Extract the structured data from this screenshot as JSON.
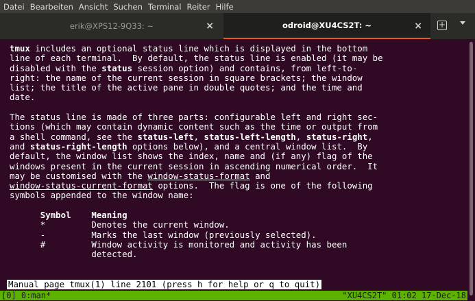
{
  "menu": [
    "Datei",
    "Bearbeiten",
    "Ansicht",
    "Suchen",
    "Terminal",
    "Reiter",
    "Hilfe"
  ],
  "tabs": [
    {
      "label": "erik@XPS12-9Q33: ~",
      "active": false
    },
    {
      "label": "odroid@XU4CS2T: ~",
      "active": true
    }
  ],
  "tab_close_glyph": "×",
  "newtab_glyph": "+",
  "terminal": {
    "para1": [
      {
        "t": "tmux",
        "b": true
      },
      {
        "t": " includes an optional status line which is displayed in the bottom\nline of each terminal.  By default, the status line is enabled (it may be\ndisabled with the "
      },
      {
        "t": "status",
        "b": true
      },
      {
        "t": " session option) and contains, from left-to-\nright: the name of the current session in square brackets; the window\nlist; the title of the active pane in double quotes; and the time and\ndate."
      }
    ],
    "para2": [
      {
        "t": "\n\nThe status line is made of three parts: configurable left and right sec-\ntions (which may contain dynamic content such as the time or output from\na shell command, see the "
      },
      {
        "t": "status-left",
        "b": true
      },
      {
        "t": ", "
      },
      {
        "t": "status-left-length",
        "b": true
      },
      {
        "t": ", "
      },
      {
        "t": "status-right",
        "b": true
      },
      {
        "t": ",\nand "
      },
      {
        "t": "status-right-length",
        "b": true
      },
      {
        "t": " options below), and a central window list.  By\ndefault, the window list shows the index, name and (if any) flag of the\nwindows present in the current session in ascending numerical order.  It\nmay be customised with the "
      },
      {
        "t": "window-status-format",
        "u": true
      },
      {
        "t": " and\n"
      },
      {
        "t": "window-status-current-format",
        "u": true
      },
      {
        "t": " options.  The flag is one of the following\nsymbols appended to the window name:"
      }
    ],
    "table": [
      {
        "t": "\n\n      "
      },
      {
        "t": "Symbol",
        "b": true
      },
      {
        "t": "    "
      },
      {
        "t": "Meaning",
        "b": true
      },
      {
        "t": "\n      *         Denotes the current window.\n      -         Marks the last window (previously selected).\n      #         Window activity is monitored and activity has been\n                detected."
      }
    ]
  },
  "prompt": "Manual page tmux(1) line 2101 (press h for help or q to quit)",
  "status_bar": {
    "left": "[0] 0:man*",
    "right": "\"XU4CS2T\" 01:02 17-Dec-18"
  }
}
